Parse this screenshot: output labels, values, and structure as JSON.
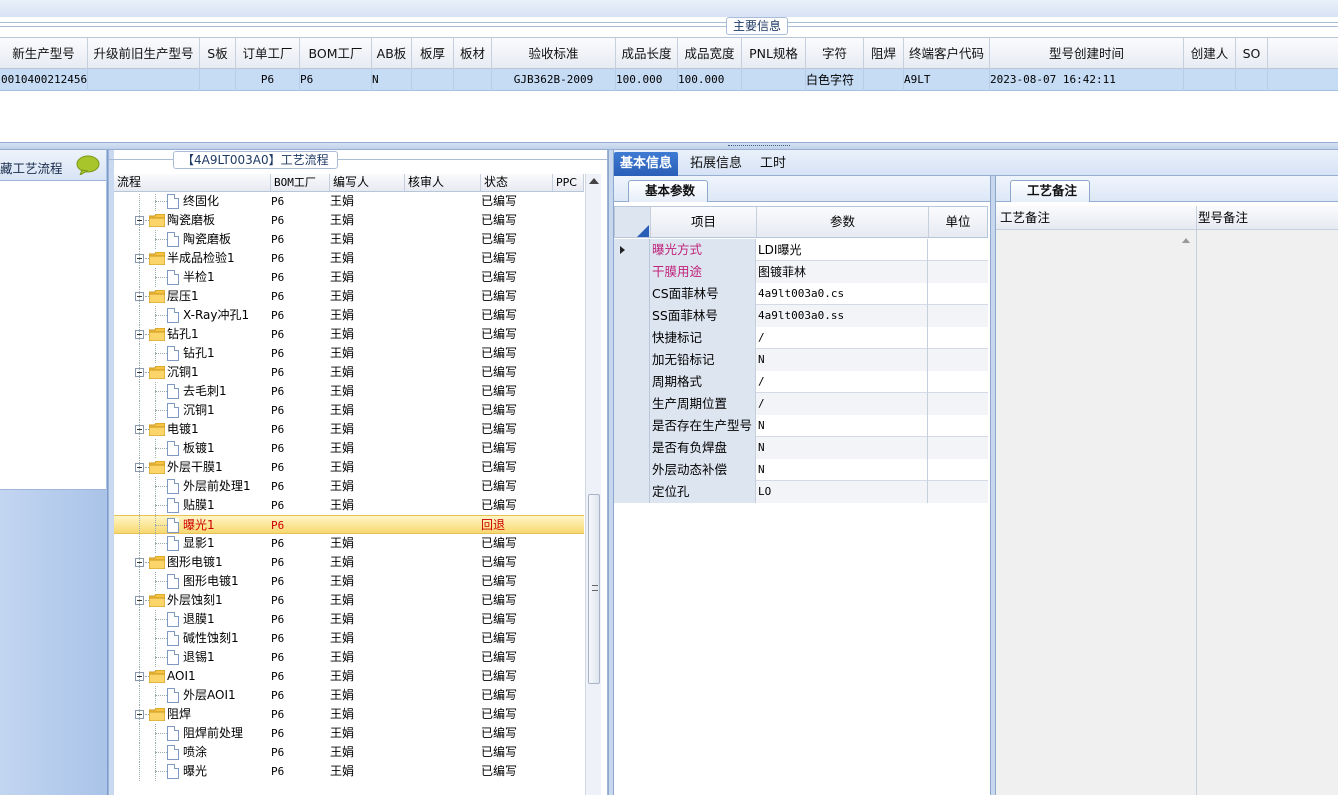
{
  "main_section": {
    "title": "主要信息",
    "columns": [
      "新生产型号",
      "升级前旧生产型号",
      "S板",
      "订单工厂",
      "BOM工厂",
      "AB板",
      "板厚",
      "板材",
      "验收标准",
      "成品长度",
      "成品宽度",
      "PNL规格",
      "字符",
      "阻焊",
      "终端客户代码",
      "型号创建时间",
      "创建人",
      "SO"
    ],
    "row": {
      "new_model": "0010400212456",
      "order_factory": "P6",
      "bom_factory": "P6",
      "ab_board": "N",
      "standard": "GJB362B-2009",
      "length": "100.000",
      "width": "100.000",
      "character": "白色字符",
      "customer_code": "A9LT",
      "created_time": "2023-08-07 16:42:11"
    }
  },
  "left_panel": {
    "title": "藏工艺流程",
    "chat_icon": "speech-bubble-icon"
  },
  "tree": {
    "title": "【4A9LT003A0】工艺流程",
    "columns": [
      "流程",
      "BOM工厂",
      "编写人",
      "核审人",
      "状态",
      "PPC"
    ],
    "rows": [
      {
        "name": "终固化",
        "factory": "P6",
        "author": "王娟",
        "status": "已编写",
        "level": 2
      },
      {
        "name": "陶瓷磨板",
        "factory": "P6",
        "author": "王娟",
        "status": "已编写",
        "level": 1
      },
      {
        "name": "陶瓷磨板",
        "factory": "P6",
        "author": "王娟",
        "status": "已编写",
        "level": 2
      },
      {
        "name": "半成品检验1",
        "factory": "P6",
        "author": "王娟",
        "status": "已编写",
        "level": 1
      },
      {
        "name": "半检1",
        "factory": "P6",
        "author": "王娟",
        "status": "已编写",
        "level": 2
      },
      {
        "name": "层压1",
        "factory": "P6",
        "author": "王娟",
        "status": "已编写",
        "level": 1
      },
      {
        "name": "X-Ray冲孔1",
        "factory": "P6",
        "author": "王娟",
        "status": "已编写",
        "level": 2
      },
      {
        "name": "钻孔1",
        "factory": "P6",
        "author": "王娟",
        "status": "已编写",
        "level": 1
      },
      {
        "name": "钻孔1",
        "factory": "P6",
        "author": "王娟",
        "status": "已编写",
        "level": 2
      },
      {
        "name": "沉铜1",
        "factory": "P6",
        "author": "王娟",
        "status": "已编写",
        "level": 1
      },
      {
        "name": "去毛刺1",
        "factory": "P6",
        "author": "王娟",
        "status": "已编写",
        "level": 2
      },
      {
        "name": "沉铜1",
        "factory": "P6",
        "author": "王娟",
        "status": "已编写",
        "level": 2
      },
      {
        "name": "电镀1",
        "factory": "P6",
        "author": "王娟",
        "status": "已编写",
        "level": 1
      },
      {
        "name": "板镀1",
        "factory": "P6",
        "author": "王娟",
        "status": "已编写",
        "level": 2
      },
      {
        "name": "外层干膜1",
        "factory": "P6",
        "author": "王娟",
        "status": "已编写",
        "level": 1
      },
      {
        "name": "外层前处理1",
        "factory": "P6",
        "author": "王娟",
        "status": "已编写",
        "level": 2
      },
      {
        "name": "贴膜1",
        "factory": "P6",
        "author": "王娟",
        "status": "已编写",
        "level": 2
      },
      {
        "name": "曝光1",
        "factory": "P6",
        "author": "",
        "status": "回退",
        "level": 2,
        "selected": true
      },
      {
        "name": "显影1",
        "factory": "P6",
        "author": "王娟",
        "status": "已编写",
        "level": 2
      },
      {
        "name": "图形电镀1",
        "factory": "P6",
        "author": "王娟",
        "status": "已编写",
        "level": 1
      },
      {
        "name": "图形电镀1",
        "factory": "P6",
        "author": "王娟",
        "status": "已编写",
        "level": 2
      },
      {
        "name": "外层蚀刻1",
        "factory": "P6",
        "author": "王娟",
        "status": "已编写",
        "level": 1
      },
      {
        "name": "退膜1",
        "factory": "P6",
        "author": "王娟",
        "status": "已编写",
        "level": 2
      },
      {
        "name": "碱性蚀刻1",
        "factory": "P6",
        "author": "王娟",
        "status": "已编写",
        "level": 2
      },
      {
        "name": "退锡1",
        "factory": "P6",
        "author": "王娟",
        "status": "已编写",
        "level": 2
      },
      {
        "name": "AOI1",
        "factory": "P6",
        "author": "王娟",
        "status": "已编写",
        "level": 1
      },
      {
        "name": "外层AOI1",
        "factory": "P6",
        "author": "王娟",
        "status": "已编写",
        "level": 2
      },
      {
        "name": "阻焊",
        "factory": "P6",
        "author": "王娟",
        "status": "已编写",
        "level": 1
      },
      {
        "name": "阻焊前处理",
        "factory": "P6",
        "author": "王娟",
        "status": "已编写",
        "level": 2
      },
      {
        "name": "喷涂",
        "factory": "P6",
        "author": "王娟",
        "status": "已编写",
        "level": 2
      },
      {
        "name": "曝光",
        "factory": "P6",
        "author": "王娟",
        "status": "已编写",
        "level": 2
      }
    ]
  },
  "tabs": [
    "基本信息",
    "拓展信息",
    "工时"
  ],
  "basic_params": {
    "subtab": "基本参数",
    "columns": [
      "项目",
      "参数",
      "单位"
    ],
    "rows": [
      {
        "item": "曝光方式",
        "value": "LDI曝光",
        "pink": true
      },
      {
        "item": "干膜用途",
        "value": "图镀菲林",
        "pink": true
      },
      {
        "item": "CS面菲林号",
        "value": "4a9lt003a0.cs"
      },
      {
        "item": "SS面菲林号",
        "value": "4a9lt003a0.ss"
      },
      {
        "item": "快捷标记",
        "value": "/"
      },
      {
        "item": "加无铅标记",
        "value": "N"
      },
      {
        "item": "周期格式",
        "value": "/"
      },
      {
        "item": "生产周期位置",
        "value": "/"
      },
      {
        "item": "是否存在生产型号",
        "value": "N"
      },
      {
        "item": "是否有负焊盘",
        "value": "N"
      },
      {
        "item": "外层动态补偿",
        "value": "N"
      },
      {
        "item": "定位孔",
        "value": "LO"
      }
    ]
  },
  "remarks": {
    "subtab": "工艺备注",
    "col1": "工艺备注",
    "col2": "型号备注"
  },
  "colors": {
    "accent_tab": "#2a5fb8",
    "selected_row": "#c6dcf5",
    "rollback_red": "#cc0000",
    "pink_label": "#c0237a"
  }
}
